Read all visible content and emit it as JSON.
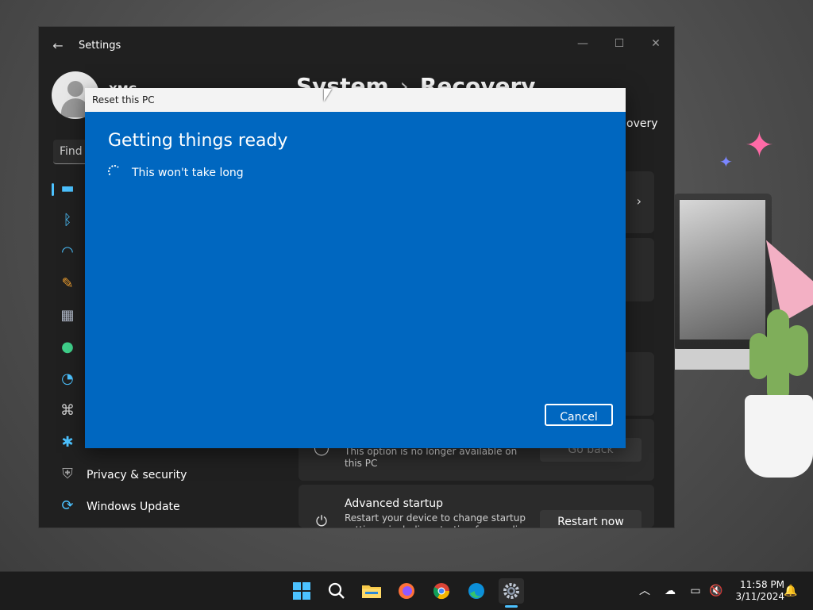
{
  "settings_window": {
    "title": "Settings",
    "user_name": "XMC",
    "search_placeholder": "Find a",
    "breadcrumb": {
      "parent": "System",
      "separator": "›",
      "current": "Recovery"
    },
    "header_partial": "overy",
    "nav": [
      {
        "icon": "system-icon",
        "label": ""
      },
      {
        "icon": "bluetooth-icon",
        "label": ""
      },
      {
        "icon": "wifi-icon",
        "label": ""
      },
      {
        "icon": "personalization-brush-icon",
        "label": ""
      },
      {
        "icon": "apps-icon",
        "label": ""
      },
      {
        "icon": "accounts-icon",
        "label": ""
      },
      {
        "icon": "time-language-icon",
        "label": ""
      },
      {
        "icon": "gaming-icon",
        "label": ""
      },
      {
        "icon": "accessibility-icon",
        "label": ""
      },
      {
        "icon": "shield-icon",
        "label": "Privacy & security"
      },
      {
        "icon": "windows-update-icon",
        "label": "Windows Update"
      }
    ],
    "cards": {
      "go_back": {
        "desc": "This option is no longer available on this PC",
        "button": "Go back"
      },
      "advanced": {
        "title": "Advanced startup",
        "desc": "Restart your device to change startup settings, including starting from a disc",
        "button": "Restart now"
      }
    }
  },
  "dialog": {
    "title": "Reset this PC",
    "heading": "Getting things ready",
    "message": "This won't take long",
    "cancel_label": "Cancel",
    "color": "#0067c0"
  },
  "taskbar": {
    "apps": [
      "start-icon",
      "search-icon",
      "file-explorer-icon",
      "firefox-icon",
      "chrome-icon",
      "edge-icon",
      "settings-icon"
    ],
    "active_app": "settings-icon",
    "time": "11:58 PM",
    "date": "3/11/2024"
  }
}
